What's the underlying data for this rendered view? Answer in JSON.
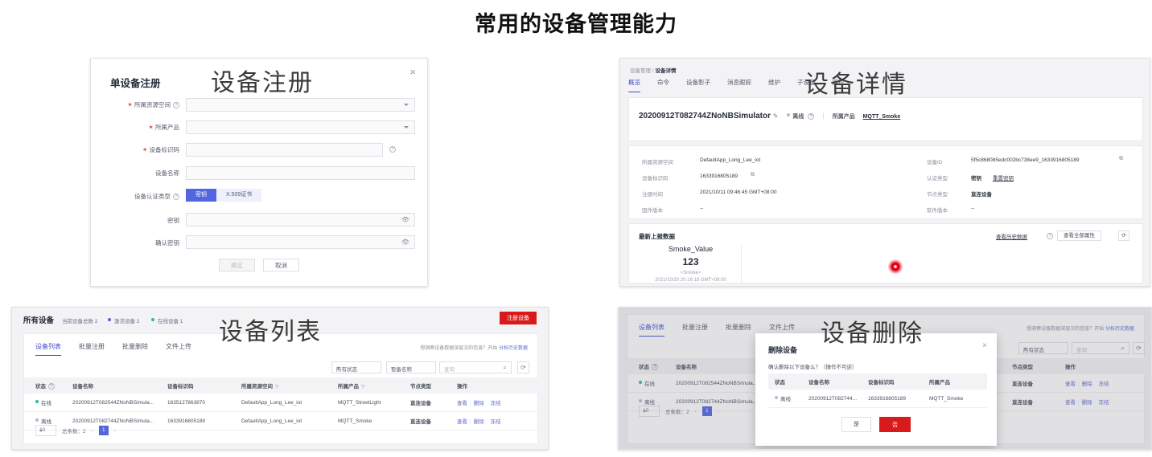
{
  "page": {
    "title": "常用的设备管理能力"
  },
  "overlays": {
    "register": "设备注册",
    "detail": "设备详情",
    "list": "设备列表",
    "delete": "设备删除"
  },
  "register_dialog": {
    "title": "单设备注册",
    "close_icon": "×",
    "fields": [
      {
        "label": "所属资源空间",
        "required": true,
        "help": true,
        "type": "select",
        "value": ""
      },
      {
        "label": "所属产品",
        "required": true,
        "help": false,
        "type": "select",
        "value": ""
      },
      {
        "label": "设备标识码",
        "required": true,
        "help": false,
        "type": "text",
        "value": "",
        "trailing_help": true
      },
      {
        "label": "设备名称",
        "required": false,
        "help": false,
        "type": "text",
        "value": ""
      }
    ],
    "auth_label": "设备认证类型",
    "auth_options": [
      "密钥",
      "X.509证书"
    ],
    "auth_selected": "密钥",
    "secret_label": "密钥",
    "secret_value": "",
    "confirm_label": "确认密钥",
    "confirm_value": "",
    "ok_label": "确定",
    "cancel_label": "取消"
  },
  "detail": {
    "breadcrumb_parent": "设备管理",
    "breadcrumb_current": "设备详情",
    "tabs": [
      "概览",
      "命令",
      "设备影子",
      "消息跟踪",
      "维护",
      "子设备",
      "监控"
    ],
    "active_tab": "概览",
    "device_name": "20200912T082744ZNoNBSimulator",
    "edit_icon": "✎",
    "status": "离线",
    "product_label": "所属产品",
    "product_value": "MQTT_Smoke",
    "info_left": [
      {
        "k": "所属资源空间",
        "v": "DefaultApp_Long_Lee_iot"
      },
      {
        "k": "设备标识码",
        "v": "1633916805189",
        "copy": true
      },
      {
        "k": "注册时间",
        "v": "2021/10/11 09:46:45 GMT+08:00"
      },
      {
        "k": "固件版本",
        "v": "--"
      }
    ],
    "info_right": [
      {
        "k": "设备ID",
        "v": "5f5c868085edc002bc738ee9_1633916805189",
        "copy": true
      },
      {
        "k": "认证类型",
        "v": "密钥",
        "link": "重置密钥"
      },
      {
        "k": "节点类型",
        "v": "直连设备"
      },
      {
        "k": "软件版本",
        "v": "--"
      }
    ],
    "latest_title": "最新上报数据",
    "history_link": "查看历史数据",
    "all_props_btn": "查看全部属性",
    "refresh_icon": "⟳",
    "property": {
      "name": "Smoke_Value",
      "value": "123",
      "service": "<Smoke>",
      "time": "2021/10/20 20:16:18 GMT+08:00"
    }
  },
  "device_list": {
    "header_title": "所有设备",
    "stats": [
      {
        "text": "当前设备总数 2",
        "color": ""
      },
      {
        "text": "激活设备 2",
        "color": "#5465e0"
      },
      {
        "text": "在线设备 1",
        "color": "#23bfa5"
      }
    ],
    "register_btn": "注册设备",
    "tabs": [
      "设备列表",
      "批量注册",
      "批量删除",
      "文件上传"
    ],
    "active_tab": "设备列表",
    "hint": "想洞察设备数据深层次的信息？开始",
    "hint_link": "分析历史数据",
    "filter_status": "所有状态",
    "filter_field": "设备名称",
    "search_placeholder": "查询",
    "search_icon": "⌕",
    "refresh_icon": "⟳",
    "columns": [
      "状态",
      "设备名称",
      "设备标识码",
      "所属资源空间",
      "所属产品",
      "节点类型",
      "操作"
    ],
    "rows": [
      {
        "status": "在线",
        "status_color": "#23bfa5",
        "name": "20200912T082544ZNoNBSimula...",
        "node_id": "1635127863870",
        "space": "DefaultApp_Long_Lee_iot",
        "product": "MQTT_StreetLight",
        "node_type": "直连设备",
        "actions": [
          "查看",
          "删除",
          "冻结"
        ]
      },
      {
        "status": "离线",
        "status_color": "#b6bac4",
        "name": "20200912T082744ZNoNBSimula...",
        "node_id": "1633916805189",
        "space": "DefaultApp_Long_Lee_iot",
        "product": "MQTT_Smoke",
        "node_type": "直连设备",
        "actions": [
          "查看",
          "删除",
          "冻结"
        ]
      }
    ],
    "page_size": "10",
    "total_label": "总条数：2",
    "current_page": "1"
  },
  "device_delete": {
    "tabs": [
      "设备列表",
      "批量注册",
      "批量删除",
      "文件上传"
    ],
    "active_tab": "设备列表",
    "hint": "想洞察设备数据深层次的信息？开始",
    "hint_link": "分析历史数据",
    "filter_status": "所有状态",
    "search_placeholder": "查询",
    "search_icon": "⌕",
    "refresh_icon": "⟳",
    "bg_columns_left": [
      "状态",
      "设备名称"
    ],
    "bg_columns_right": [
      "节点类型",
      "操作"
    ],
    "bg_rows": [
      {
        "status": "在线",
        "status_color": "#23bfa5",
        "name": "20200912T082544ZNoNBSimula...",
        "node_type": "直连设备",
        "actions": [
          "查看",
          "删除",
          "冻结"
        ]
      },
      {
        "status": "离线",
        "status_color": "#b6bac4",
        "name": "20200912T082744ZNoNBSimula...",
        "node_type": "直连设备",
        "actions": [
          "查看",
          "删除",
          "冻结"
        ]
      }
    ],
    "page_size": "10",
    "total_label": "总条数：2",
    "current_page": "1",
    "dialog": {
      "title": "删除设备",
      "close_icon": "×",
      "question": "确认删除以下设备么？（操作不可逆）",
      "columns": [
        "状态",
        "设备名称",
        "设备标识码",
        "所属产品"
      ],
      "row": {
        "status": "离线",
        "status_color": "#b6bac4",
        "name": "20200912T082744...",
        "node_id": "1633916805189",
        "product": "MQTT_Smoke"
      },
      "confirm_label": "是",
      "cancel_label": "否"
    }
  }
}
